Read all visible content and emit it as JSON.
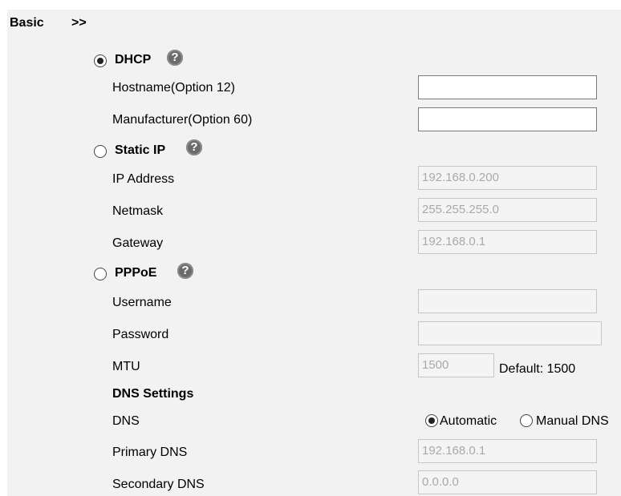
{
  "header": {
    "title": "Basic",
    "arrow": ">>"
  },
  "dhcp": {
    "label": "DHCP",
    "selected": true,
    "help_icon": "question-circle-icon",
    "hostname_label": "Hostname(Option 12)",
    "hostname_value": "",
    "manufacturer_label": "Manufacturer(Option 60)",
    "manufacturer_value": ""
  },
  "static_ip": {
    "label": "Static IP",
    "selected": false,
    "ip_label": "IP Address",
    "ip_value": "192.168.0.200",
    "netmask_label": "Netmask",
    "netmask_value": "255.255.255.0",
    "gateway_label": "Gateway",
    "gateway_value": "192.168.0.1"
  },
  "pppoe": {
    "label": "PPPoE",
    "selected": false,
    "username_label": "Username",
    "username_value": "",
    "password_label": "Password",
    "password_value": "",
    "mtu_label": "MTU",
    "mtu_value": "1500",
    "mtu_default": "Default: 1500"
  },
  "dns": {
    "section_title": "DNS Settings",
    "dns_label": "DNS",
    "automatic_label": "Automatic",
    "manual_label": "Manual DNS",
    "mode": "Automatic",
    "primary_label": "Primary DNS",
    "primary_value": "192.168.0.1",
    "secondary_label": "Secondary DNS",
    "secondary_value": "0.0.0.0"
  }
}
